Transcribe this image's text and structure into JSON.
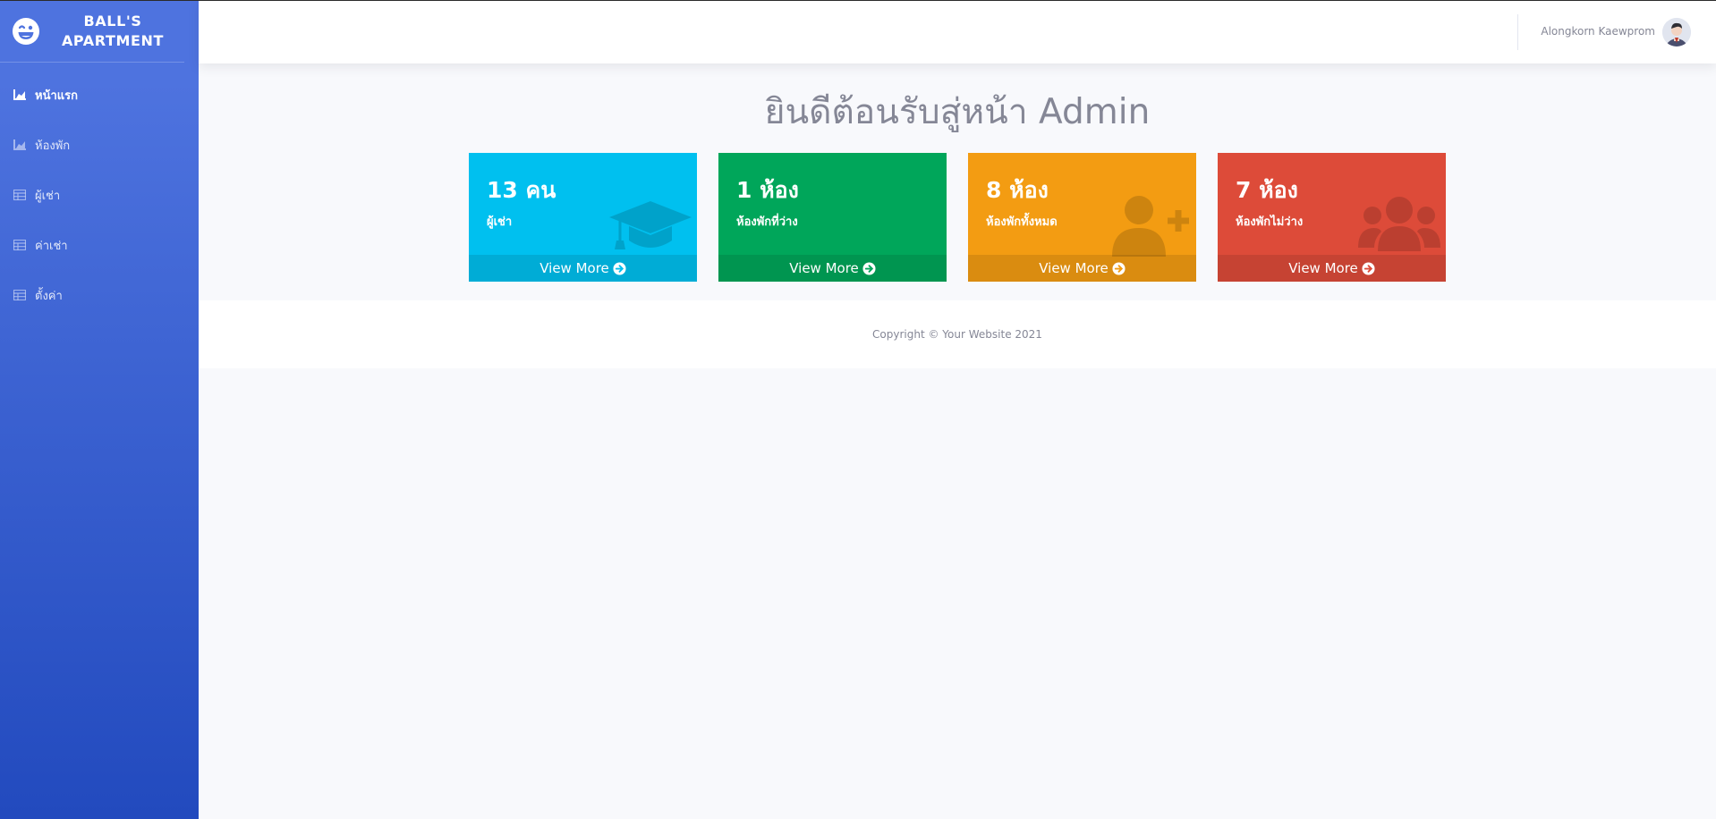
{
  "sidebar": {
    "brand_line1": "BALL'S",
    "brand_line2": "APARTMENT",
    "brand_icon": "laugh-wink-icon",
    "items": [
      {
        "label": "หน้าแรก",
        "icon": "chart-area-icon",
        "active": true
      },
      {
        "label": "ห้องพัก",
        "icon": "chart-area-icon",
        "active": false
      },
      {
        "label": "ผู้เช่า",
        "icon": "table-icon",
        "active": false
      },
      {
        "label": "ค่าเช่า",
        "icon": "table-icon",
        "active": false
      },
      {
        "label": "ตั้งค่า",
        "icon": "table-icon",
        "active": false
      }
    ]
  },
  "topbar": {
    "user_name": "Alongkorn Kaewprom",
    "avatar_icon": "user-avatar-icon"
  },
  "main": {
    "title": "ยินดีต้อนรับสู่หน้า Admin",
    "cards": [
      {
        "number": "13 คน",
        "label": "ผู้เช่า",
        "footer": "View More",
        "color": "#00c0ef",
        "icon": "graduation-cap-icon"
      },
      {
        "number": "1 ห้อง",
        "label": "ห้องพักที่ว่าง",
        "footer": "View More",
        "color": "#00a65a",
        "icon": ""
      },
      {
        "number": "8 ห้อง",
        "label": "ห้องพักทั้งหมด",
        "footer": "View More",
        "color": "#f39c12",
        "icon": "user-plus-icon"
      },
      {
        "number": "7 ห้อง",
        "label": "ห้องพักไม่ว่าง",
        "footer": "View More",
        "color": "#dd4b39",
        "icon": "users-icon"
      }
    ]
  },
  "footer": {
    "copyright": "Copyright © Your Website 2021"
  },
  "colors": {
    "sidebar_top": "#4e73df",
    "sidebar_bottom": "#224abe",
    "background": "#f8f9fc"
  }
}
